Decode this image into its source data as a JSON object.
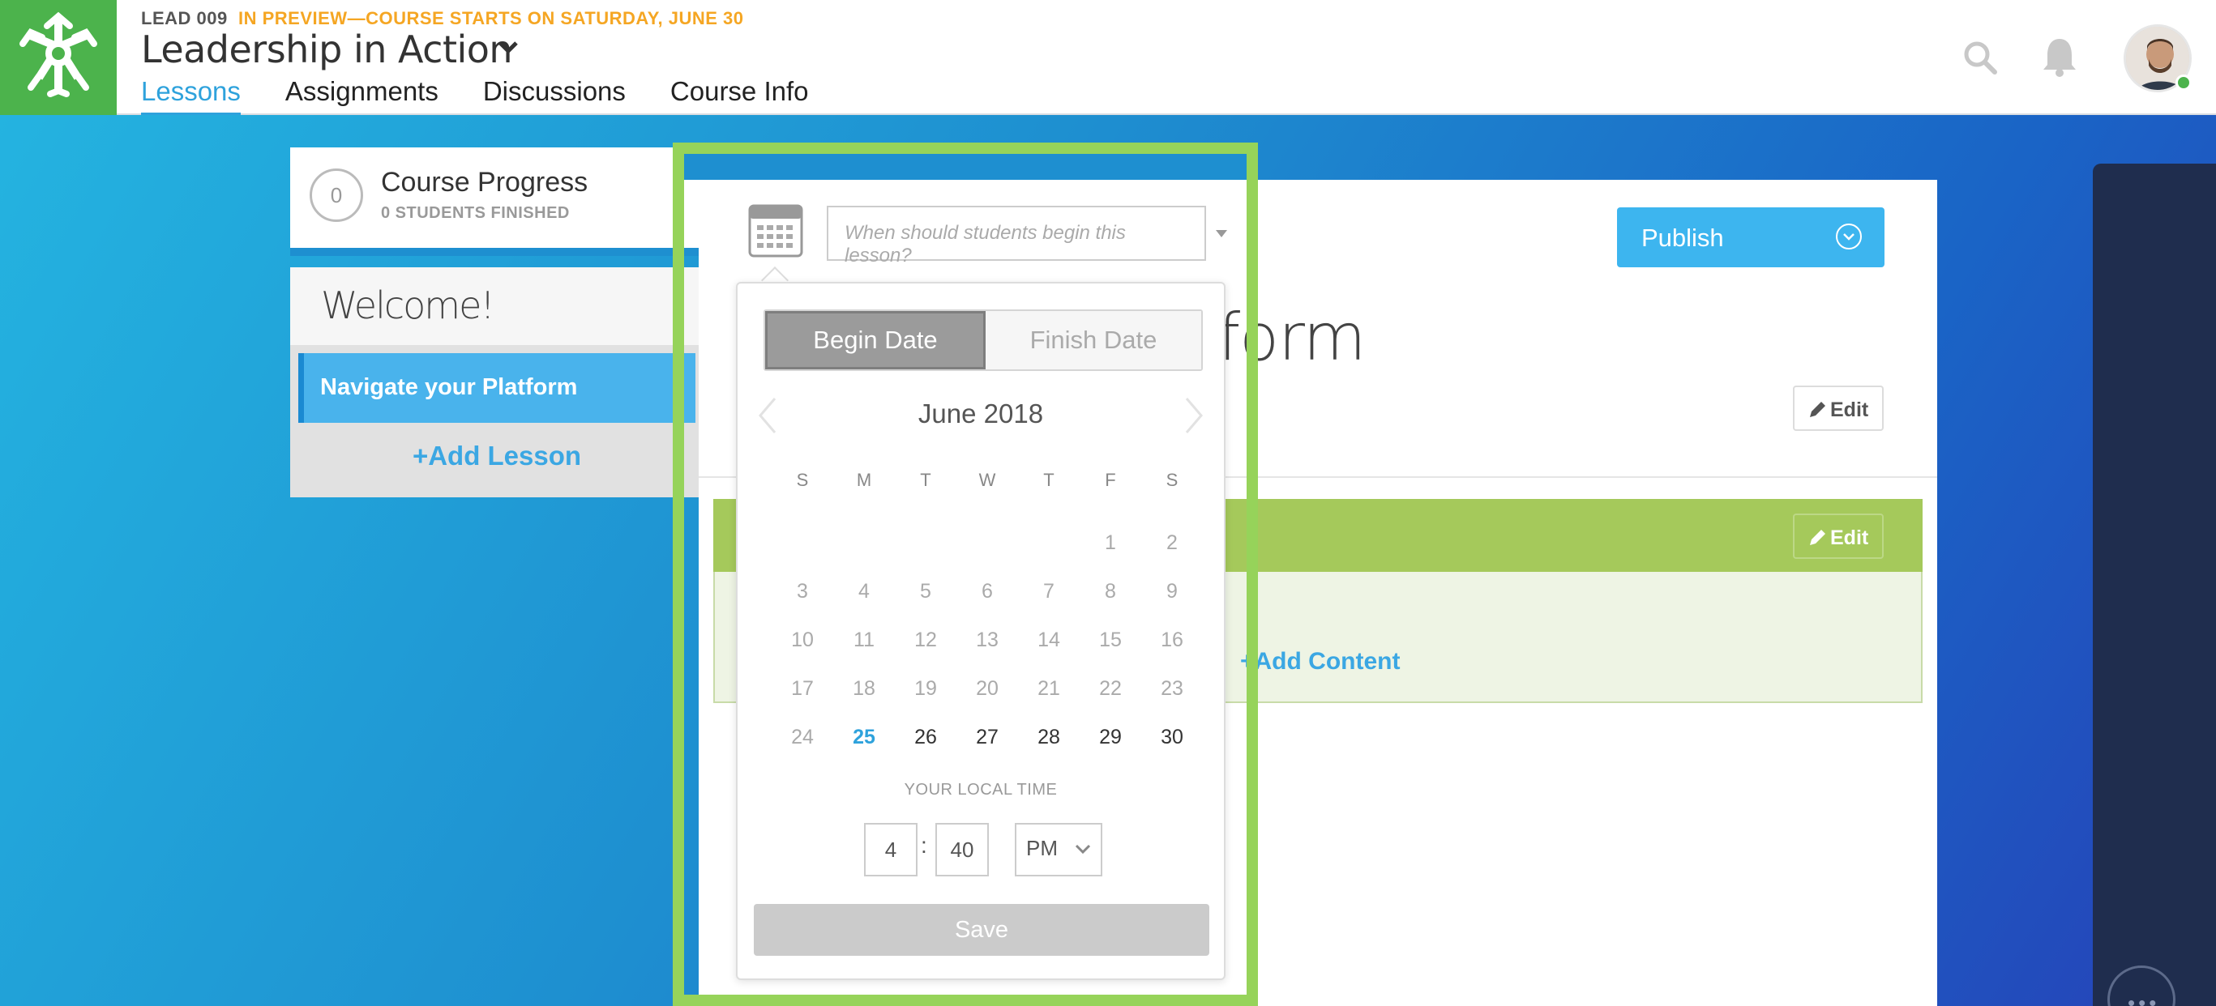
{
  "header": {
    "course_code": "LEAD 009",
    "preview_note": "IN PREVIEW—COURSE STARTS ON SATURDAY, JUNE 30",
    "course_title": "Leadership in Action",
    "tabs": [
      {
        "label": "Lessons",
        "active": true
      },
      {
        "label": "Assignments",
        "active": false
      },
      {
        "label": "Discussions",
        "active": false
      },
      {
        "label": "Course Info",
        "active": false
      }
    ],
    "icons": [
      "search-icon",
      "bell-icon"
    ],
    "avatar_status_color": "#4cb34c"
  },
  "sidebar": {
    "progress": {
      "count": "0",
      "title": "Course Progress",
      "subtitle": "0 STUDENTS FINISHED"
    },
    "welcome": "Welcome!",
    "lessons": [
      {
        "label": "Navigate your Platform",
        "selected": true
      }
    ],
    "add_lesson": "+Add Lesson"
  },
  "content": {
    "publish_label": "Publish",
    "heading_visible_fragment": "form",
    "edit_label": "Edit",
    "add_content": "+Add Content"
  },
  "date_picker": {
    "input_placeholder": "When should students begin this lesson?",
    "toggle": [
      "Begin Date",
      "Finish Date"
    ],
    "active_toggle": "Begin Date",
    "month_label": "June 2018",
    "weekdays": [
      "S",
      "M",
      "T",
      "W",
      "T",
      "F",
      "S"
    ],
    "first_weekday_index": 5,
    "days_in_month": 30,
    "today": 25,
    "local_time_label": "YOUR LOCAL TIME",
    "hour": "4",
    "minute": "40",
    "ampm": "PM",
    "save_label": "Save"
  },
  "colors": {
    "brand_green": "#4cb34c",
    "accent_blue": "#2ea2dc",
    "highlight_green": "#96d35a",
    "section_green": "#a5c95b",
    "preview_orange": "#f5a623"
  }
}
